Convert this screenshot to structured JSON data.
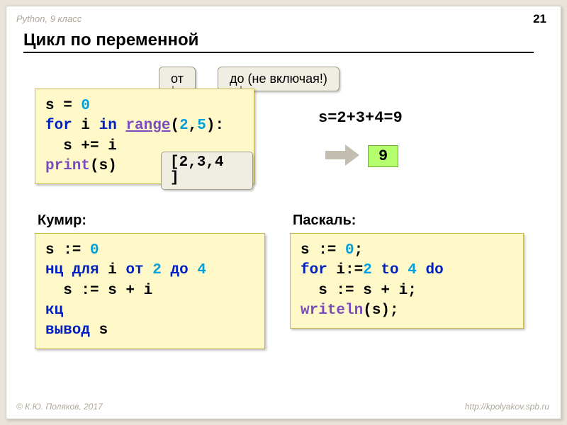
{
  "meta": {
    "context": "Python, 9 класс",
    "page_number": "21",
    "title": "Цикл по переменной",
    "footer_left": "© К.Ю. Поляков, 2017",
    "footer_right": "http://kpolyakov.spb.ru"
  },
  "callouts": {
    "from": "от",
    "to": "до (не включая!)",
    "list": "[2,3,4\n]"
  },
  "equation": "s=2+3+4=9",
  "result": "9",
  "labels": {
    "kumir": "Кумир:",
    "pascal": "Паскаль:"
  },
  "code": {
    "python": {
      "l1a": "s = ",
      "l1b": "0",
      "l2a": "for",
      "l2b": " i ",
      "l2c": "in",
      "l2d": " ",
      "l2e": "range",
      "l2f": "(",
      "l2g": "2",
      "l2h": ",",
      "l2i": "5",
      "l2j": "):",
      "l3": "  s += i",
      "l4a": "print",
      "l4b": "(s)"
    },
    "kumir": {
      "l1a": "s := ",
      "l1b": "0",
      "l2a": "нц для",
      "l2b": " i ",
      "l2c": "от",
      "l2d": " ",
      "l2e": "2",
      "l2f": " ",
      "l2g": "до",
      "l2h": " ",
      "l2i": "4",
      "l3": "  s := s + i",
      "l4": "кц",
      "l5a": "вывод",
      "l5b": " s"
    },
    "pascal": {
      "l1a": "s := ",
      "l1b": "0",
      "l1c": ";",
      "l2a": "for",
      "l2b": " i:=",
      "l2c": "2",
      "l2d": " ",
      "l2e": "to",
      "l2f": " ",
      "l2g": "4",
      "l2h": " ",
      "l2i": "do",
      "l3": "  s := s + i;",
      "l4a": "writeln",
      "l4b": "(s);"
    }
  }
}
